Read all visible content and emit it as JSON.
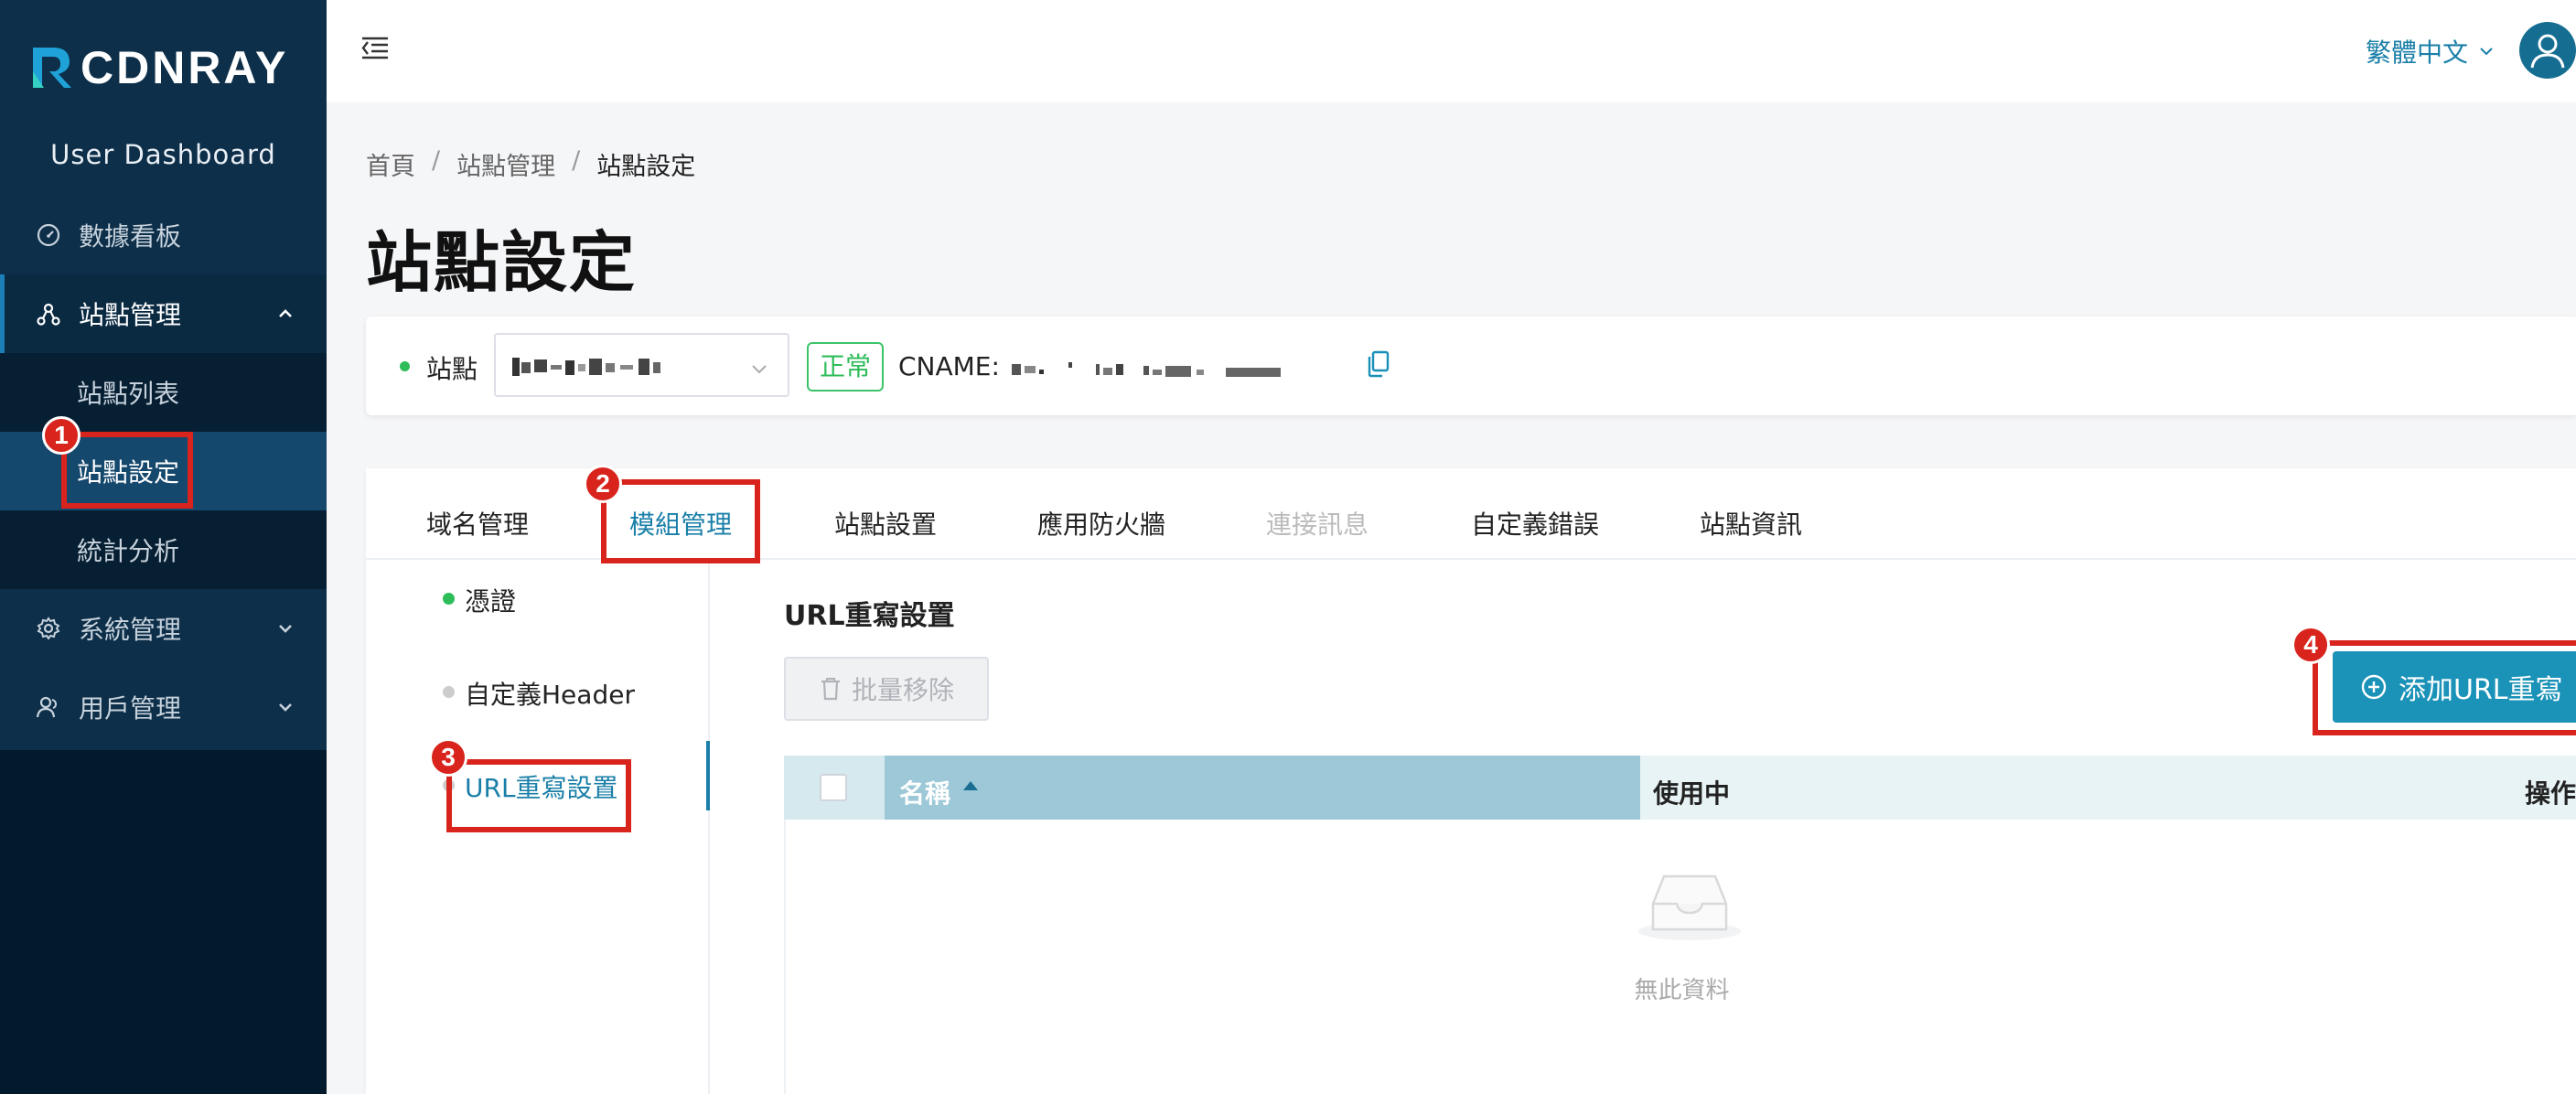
{
  "app": {
    "logo_text": "CDNRAY",
    "dashboard_title": "User Dashboard"
  },
  "sidebar": {
    "items": [
      {
        "label": "數據看板",
        "icon": "dashboard-gauge-icon"
      },
      {
        "label": "站點管理",
        "icon": "site-network-icon",
        "expanded": true
      },
      {
        "label": "系統管理",
        "icon": "gear-icon"
      },
      {
        "label": "用戶管理",
        "icon": "users-icon"
      }
    ],
    "subitems": [
      {
        "label": "站點列表"
      },
      {
        "label": "站點設定",
        "active": true
      },
      {
        "label": "統計分析"
      }
    ]
  },
  "topbar": {
    "language": "繁體中文",
    "menu_icon": "menu-collapse-icon",
    "avatar_icon": "user-avatar-icon"
  },
  "breadcrumb": [
    "首頁",
    "站點管理",
    "站點設定"
  ],
  "page_title": "站點設定",
  "site_bar": {
    "label": "站點",
    "status": "正常",
    "cname_label": "CNAME:",
    "copy_icon": "copy-icon"
  },
  "tabs": [
    {
      "label": "域名管理"
    },
    {
      "label": "模組管理",
      "active": true
    },
    {
      "label": "站點設置"
    },
    {
      "label": "應用防火牆"
    },
    {
      "label": "連接訊息",
      "disabled": true
    },
    {
      "label": "自定義錯誤"
    },
    {
      "label": "站點資訊"
    }
  ],
  "module_nav": [
    {
      "label": "憑證",
      "status": "enabled"
    },
    {
      "label": "自定義Header",
      "status": "disabled"
    },
    {
      "label": "URL重寫設置",
      "status": "disabled",
      "active": true
    }
  ],
  "section": {
    "title": "URL重寫設置",
    "batch_remove": "批量移除",
    "add_button": "添加URL重寫"
  },
  "table": {
    "columns": [
      "名稱",
      "使用中",
      "操作"
    ],
    "empty_text": "無此資料"
  },
  "annotations": [
    "1",
    "2",
    "3",
    "4"
  ],
  "colors": {
    "accent": "#1a7fa8",
    "primary_button": "#1b92b8",
    "sidebar_bg": "#0d2f49",
    "annotation_red": "#d8241c",
    "status_green": "#2ebd59"
  }
}
